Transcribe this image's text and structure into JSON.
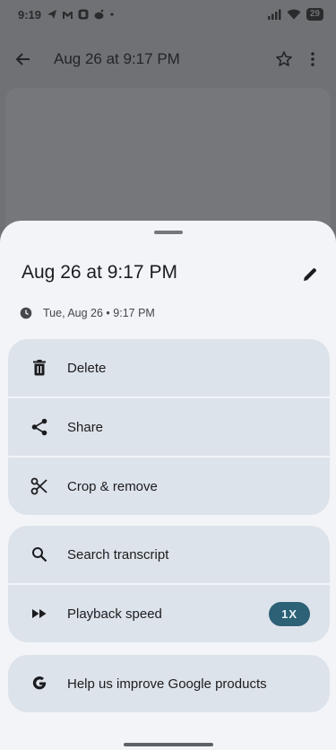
{
  "status_bar": {
    "time": "9:19",
    "battery": "29"
  },
  "top_bar": {
    "title": "Aug 26 at 9:17 PM"
  },
  "sheet": {
    "title": "Aug 26 at 9:17 PM",
    "timestamp": "Tue, Aug 26 • 9:17 PM",
    "groups": [
      {
        "items": [
          {
            "label": "Delete",
            "icon": "trash-icon"
          },
          {
            "label": "Share",
            "icon": "share-icon"
          },
          {
            "label": "Crop & remove",
            "icon": "scissors-icon"
          }
        ]
      },
      {
        "items": [
          {
            "label": "Search transcript",
            "icon": "search-icon"
          },
          {
            "label": "Playback speed",
            "icon": "fast-forward-icon",
            "badge": "1X"
          }
        ]
      },
      {
        "items": [
          {
            "label": "Help us improve Google products",
            "icon": "google-g-icon"
          }
        ]
      }
    ]
  },
  "colors": {
    "accent_badge": "#2c6176",
    "row_bg": "#dde3ea",
    "sheet_bg": "#f2f4f7"
  }
}
